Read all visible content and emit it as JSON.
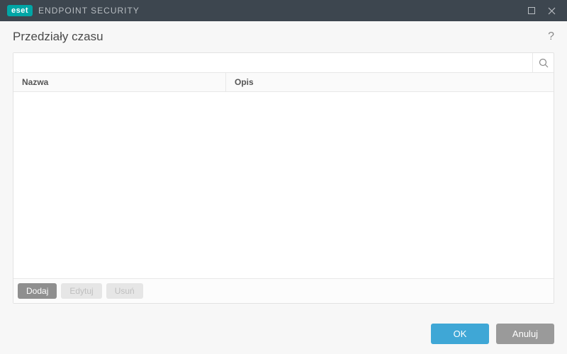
{
  "titlebar": {
    "brand": "eset",
    "app_name": "ENDPOINT SECURITY"
  },
  "header": {
    "title": "Przedziały czasu"
  },
  "search": {
    "value": "",
    "placeholder": ""
  },
  "table": {
    "columns": {
      "name": "Nazwa",
      "description": "Opis"
    },
    "rows": []
  },
  "toolbar": {
    "add": "Dodaj",
    "edit": "Edytuj",
    "delete": "Usuń"
  },
  "footer": {
    "ok": "OK",
    "cancel": "Anuluj"
  }
}
